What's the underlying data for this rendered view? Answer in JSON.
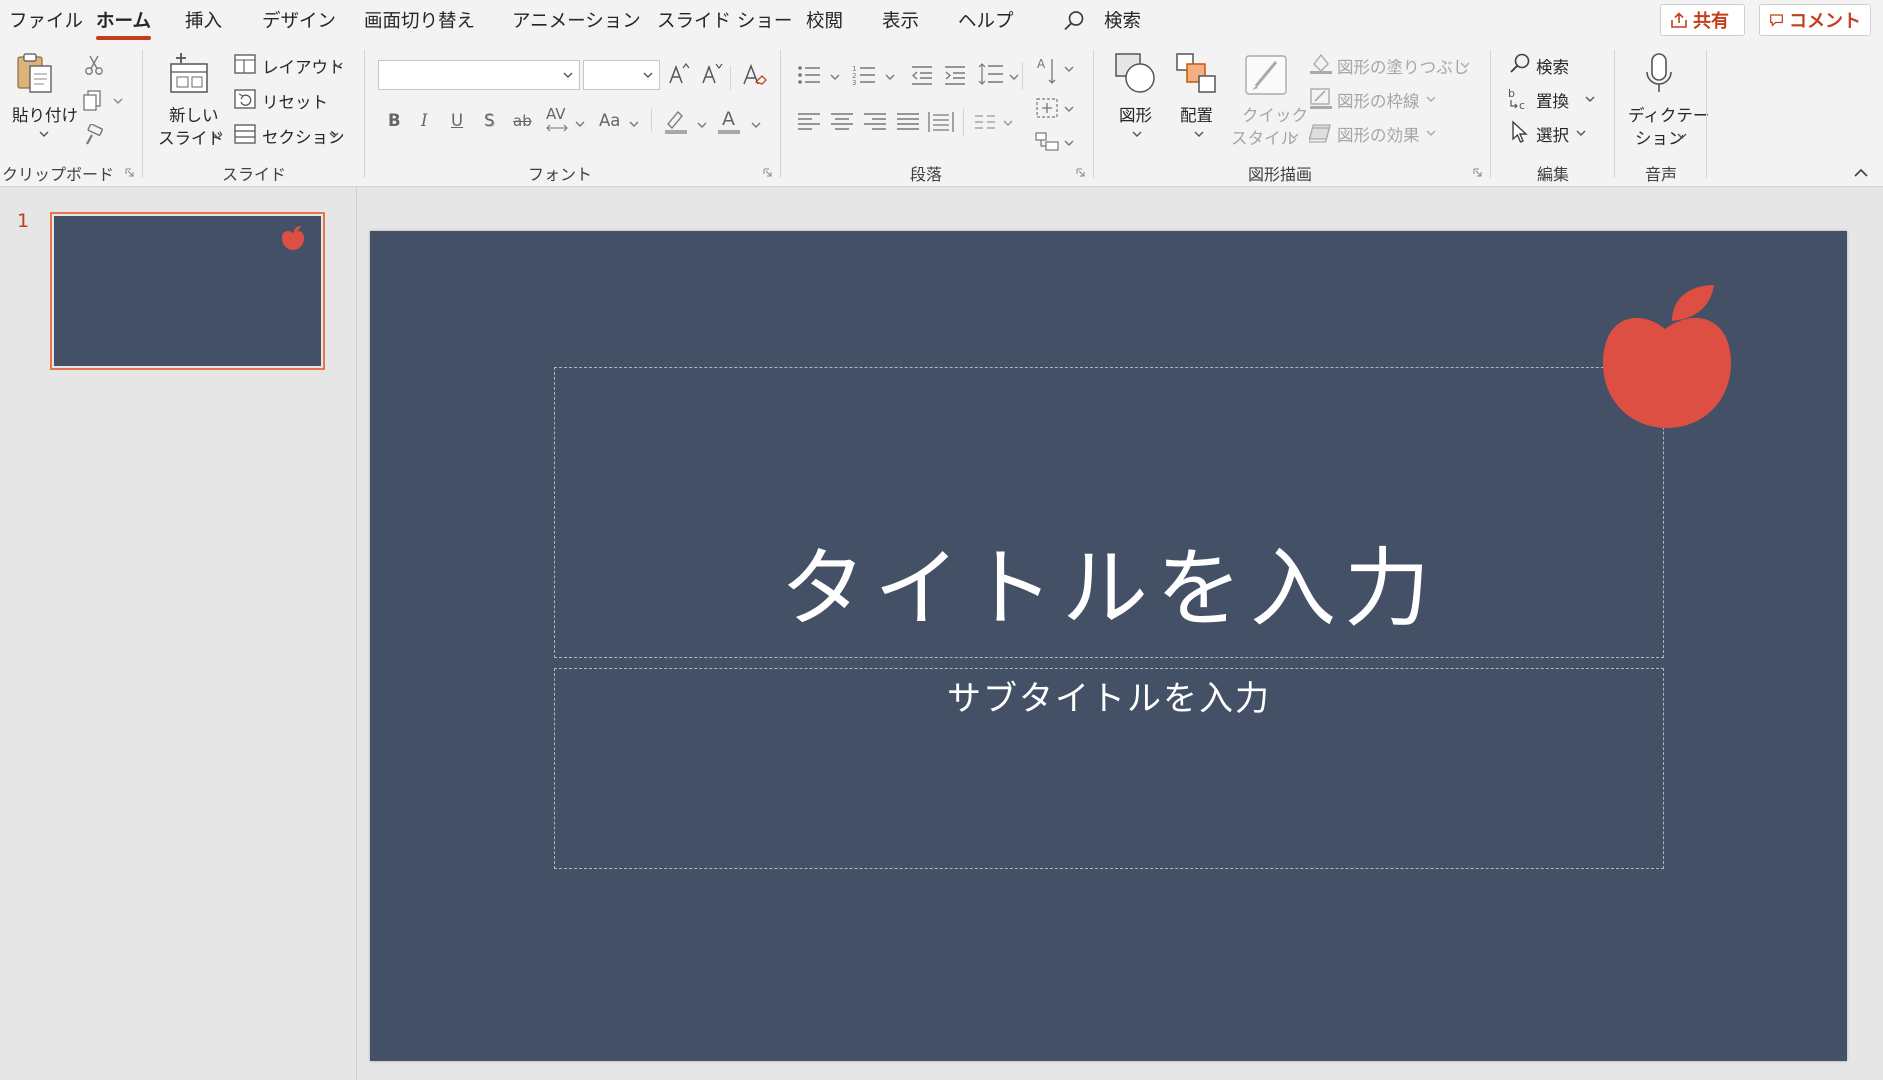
{
  "menu": {
    "tabs": [
      {
        "label": "ファイル"
      },
      {
        "label": "ホーム"
      },
      {
        "label": "挿入"
      },
      {
        "label": "デザイン"
      },
      {
        "label": "画面切り替え"
      },
      {
        "label": "アニメーション"
      },
      {
        "label": "スライド ショー"
      },
      {
        "label": "校閲"
      },
      {
        "label": "表示"
      },
      {
        "label": "ヘルプ"
      }
    ],
    "active_tab": "ホーム",
    "search_label": "検索",
    "share_label": "共有",
    "comment_label": "コメント"
  },
  "ribbon": {
    "clipboard": {
      "paste": "貼り付け",
      "group": "クリップボード"
    },
    "slides": {
      "new_slide_line1": "新しい",
      "new_slide_line2": "スライド",
      "layout": "レイアウト",
      "reset": "リセット",
      "section": "セクション",
      "group": "スライド"
    },
    "font": {
      "font_name": "",
      "font_size": "",
      "bold": "B",
      "italic": "I",
      "underline": "U",
      "shadow": "S",
      "strike": "ab",
      "spacing": "AV",
      "case": "Aa",
      "color_letter": "A",
      "group": "フォント"
    },
    "paragraph": {
      "group": "段落"
    },
    "drawing": {
      "shapes": "図形",
      "arrange": "配置",
      "quick_line1": "クイック",
      "quick_line2": "スタイル",
      "fill": "図形の塗りつぶし",
      "outline": "図形の枠線",
      "effects": "図形の効果",
      "group": "図形描画"
    },
    "editing": {
      "find": "検索",
      "replace": "置換",
      "select": "選択",
      "group": "編集"
    },
    "voice": {
      "dictate_line1": "ディクテー",
      "dictate_line2": "ション",
      "group": "音声"
    }
  },
  "thumbnails": {
    "slide_number": "1"
  },
  "slide": {
    "background": "#435066",
    "accent": "#dd4f43",
    "title": "タイトルを入力",
    "subtitle": "サブタイトルを入力"
  }
}
